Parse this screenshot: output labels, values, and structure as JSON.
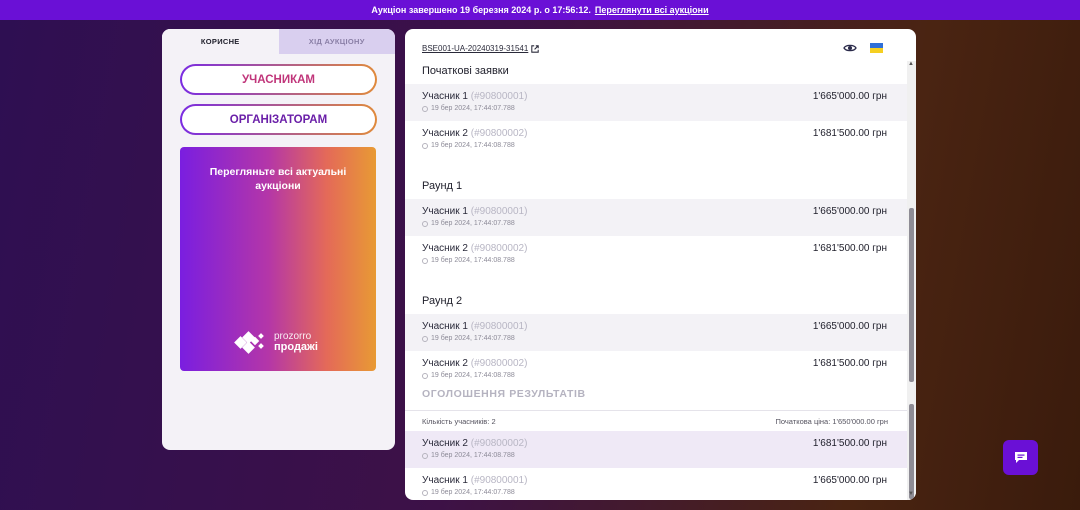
{
  "banner": {
    "text": "Аукціон завершено 19 березня 2024 р. о 17:56:12.",
    "link": "Переглянути всі аукціони"
  },
  "left_panel": {
    "tabs": [
      {
        "label": "КОРИСНЕ",
        "active": true
      },
      {
        "label": "ХІД АУКЦІОНУ",
        "active": false
      }
    ],
    "buttons": {
      "participants": "УЧАСНИКАМ",
      "organizers": "ОРГАНІЗАТОРАМ"
    },
    "promo": {
      "text": "Перегляньте всі актуальні аукціони",
      "logo_line1": "prozorro",
      "logo_line2": "продажі"
    }
  },
  "right_panel": {
    "auction_id": "BSE001-UA-20240319-31541",
    "icons": {
      "view": "eye-icon",
      "language": "ukraine-flag-icon"
    },
    "sections": [
      {
        "title": "Початкові заявки",
        "rows": [
          {
            "name": "Учасник 1",
            "code": "(#90800001)",
            "time": "19 бер 2024, 17:44:07.788",
            "amount": "1'665'000.00 грн"
          },
          {
            "name": "Учасник 2",
            "code": "(#90800002)",
            "time": "19 бер 2024, 17:44:08.788",
            "amount": "1'681'500.00 грн"
          }
        ]
      },
      {
        "title": "Раунд 1",
        "rows": [
          {
            "name": "Учасник 1",
            "code": "(#90800001)",
            "time": "19 бер 2024, 17:44:07.788",
            "amount": "1'665'000.00 грн"
          },
          {
            "name": "Учасник 2",
            "code": "(#90800002)",
            "time": "19 бер 2024, 17:44:08.788",
            "amount": "1'681'500.00 грн"
          }
        ]
      },
      {
        "title": "Раунд 2",
        "rows": [
          {
            "name": "Учасник 1",
            "code": "(#90800001)",
            "time": "19 бер 2024, 17:44:07.788",
            "amount": "1'665'000.00 грн"
          },
          {
            "name": "Учасник 2",
            "code": "(#90800002)",
            "time": "19 бер 2024, 17:44:08.788",
            "amount": "1'681'500.00 грн"
          }
        ]
      }
    ],
    "results": {
      "title": "ОГОЛОШЕННЯ РЕЗУЛЬТАТІВ",
      "participants_count": "Кількість учасників: 2",
      "initial_price": "Початкова ціна: 1'650'000.00 грн",
      "rows": [
        {
          "name": "Учасник 2",
          "code": "(#90800002)",
          "time": "19 бер 2024, 17:44:08.788",
          "amount": "1'681'500.00 грн"
        },
        {
          "name": "Учасник 1",
          "code": "(#90800001)",
          "time": "19 бер 2024, 17:44:07.788",
          "amount": "1'665'000.00 грн"
        }
      ]
    }
  },
  "chat": {
    "icon": "chat-icon"
  },
  "colors": {
    "accent": "#6a10d6",
    "banner": "#6a10d6"
  }
}
